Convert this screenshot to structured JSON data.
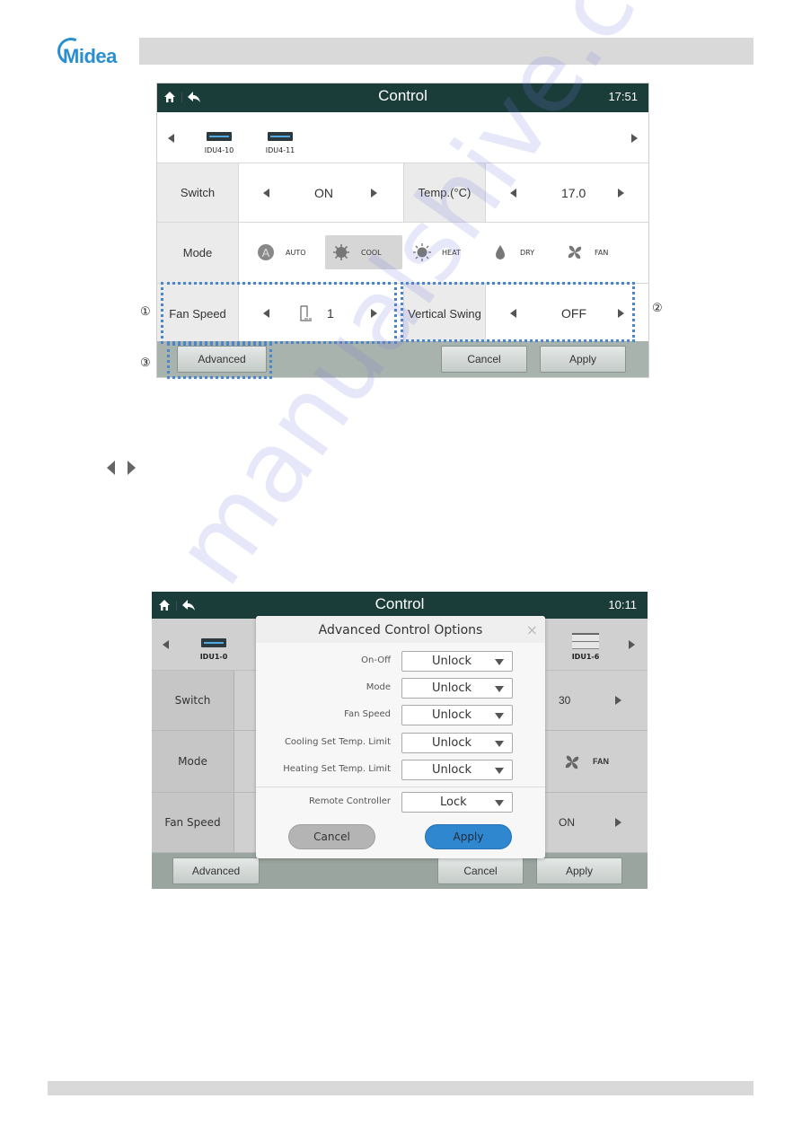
{
  "page": {
    "brand": "Midea",
    "watermark": "manualshive.com",
    "nav_arrows_icons": [
      "left-arrow-icon",
      "right-arrow-icon"
    ]
  },
  "screen1": {
    "title": "Control",
    "time": "17:51",
    "units": [
      {
        "name": "IDU4-10"
      },
      {
        "name": "IDU4-11"
      }
    ],
    "switch": {
      "label": "Switch",
      "value": "ON"
    },
    "temp": {
      "label": "Temp.(°C)",
      "value": "17.0"
    },
    "mode": {
      "label": "Mode",
      "options": [
        {
          "label": "AUTO",
          "icon": "auto-icon",
          "selected": false
        },
        {
          "label": "COOL",
          "icon": "snowflake-icon",
          "selected": true
        },
        {
          "label": "HEAT",
          "icon": "sun-icon",
          "selected": false
        },
        {
          "label": "DRY",
          "icon": "droplet-icon",
          "selected": false
        },
        {
          "label": "FAN",
          "icon": "fan-icon",
          "selected": false
        }
      ]
    },
    "fan_speed": {
      "label": "Fan Speed",
      "value": "1"
    },
    "vertical_swing": {
      "label": "Vertical Swing",
      "value": "OFF"
    },
    "buttons": {
      "advanced": "Advanced",
      "cancel": "Cancel",
      "apply": "Apply"
    },
    "callouts": {
      "one": "①",
      "two": "②",
      "three": "③"
    },
    "highlight_color": "#4a86c8"
  },
  "screen2": {
    "title": "Control",
    "time": "10:11",
    "units": [
      {
        "name": "IDU1-0"
      },
      {
        "name": "IDU1-6"
      }
    ],
    "rows": {
      "switch": {
        "label": "Switch",
        "visible_value": "30"
      },
      "mode": {
        "label": "Mode",
        "visible_value": "FAN"
      },
      "fan_speed": {
        "label": "Fan Speed",
        "visible_value": "ON"
      }
    },
    "buttons": {
      "advanced": "Advanced",
      "cancel": "Cancel",
      "apply": "Apply"
    },
    "dialog": {
      "title": "Advanced Control Options",
      "close": "×",
      "options": [
        {
          "label": "On-Off",
          "value": "Unlock"
        },
        {
          "label": "Mode",
          "value": "Unlock"
        },
        {
          "label": "Fan Speed",
          "value": "Unlock"
        },
        {
          "label": "Cooling Set Temp. Limit",
          "value": "Unlock"
        },
        {
          "label": "Heating Set Temp. Limit",
          "value": "Unlock"
        }
      ],
      "remote": {
        "label": "Remote Controller",
        "value": "Lock"
      },
      "cancel": "Cancel",
      "apply": "Apply",
      "apply_color": "#2f87d0"
    }
  }
}
